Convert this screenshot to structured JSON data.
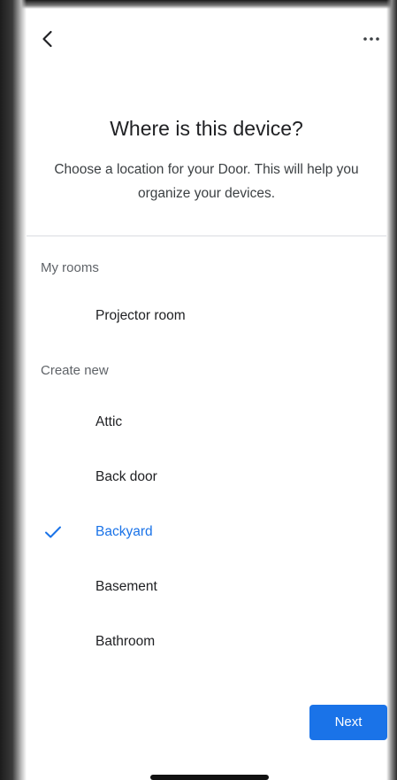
{
  "header": {
    "back_icon": "chevron-left-icon",
    "more_icon": "more-horizontal-icon"
  },
  "title": "Where is this device?",
  "subtitle": "Choose a location for your Door. This will help you organize your devices.",
  "sections": {
    "my_rooms": {
      "label": "My rooms",
      "items": [
        "Projector room"
      ]
    },
    "create_new": {
      "label": "Create new",
      "items": [
        "Attic",
        "Back door",
        "Backyard",
        "Basement",
        "Bathroom"
      ]
    }
  },
  "selected_room": "Backyard",
  "next_label": "Next",
  "colors": {
    "accent": "#1a73e8",
    "text": "#202124",
    "secondary_text": "#5f6368"
  }
}
